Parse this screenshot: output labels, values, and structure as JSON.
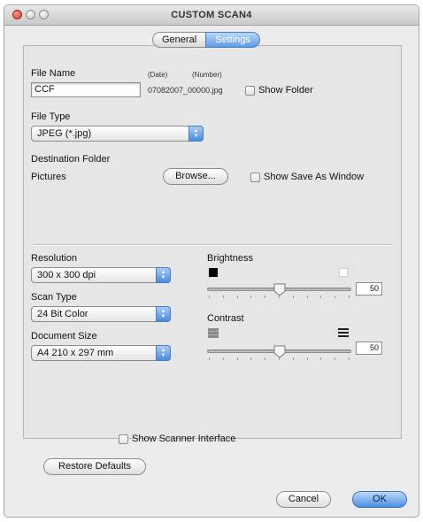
{
  "window": {
    "title": "CUSTOM SCAN4",
    "colors": {
      "accent": "#5d9ae4",
      "close_button": "#d1342a"
    }
  },
  "tabs": [
    {
      "label": "General",
      "selected": false
    },
    {
      "label": "Settings",
      "selected": true
    }
  ],
  "file_name": {
    "label": "File Name",
    "value": "CCF",
    "date_label": "(Date)",
    "number_label": "(Number)",
    "example": "07082007_00000.jpg",
    "show_folder_label": "Show Folder",
    "show_folder_checked": false
  },
  "file_type": {
    "label": "File Type",
    "selected": "JPEG (*.jpg)"
  },
  "destination": {
    "label": "Destination Folder",
    "folder": "Pictures",
    "browse_label": "Browse...",
    "show_save_as_label": "Show Save As Window",
    "show_save_as_checked": false
  },
  "resolution": {
    "label": "Resolution",
    "selected": "300 x 300 dpi"
  },
  "scan_type": {
    "label": "Scan Type",
    "selected": "24 Bit Color"
  },
  "document_size": {
    "label": "Document Size",
    "selected": "A4  210 x 297 mm"
  },
  "brightness": {
    "label": "Brightness",
    "value": "50",
    "min": 0,
    "max": 100
  },
  "contrast": {
    "label": "Contrast",
    "value": "50",
    "min": 0,
    "max": 100
  },
  "show_scanner_interface": {
    "label": "Show Scanner Interface",
    "checked": false
  },
  "buttons": {
    "restore_defaults": "Restore Defaults",
    "cancel": "Cancel",
    "ok": "OK"
  }
}
